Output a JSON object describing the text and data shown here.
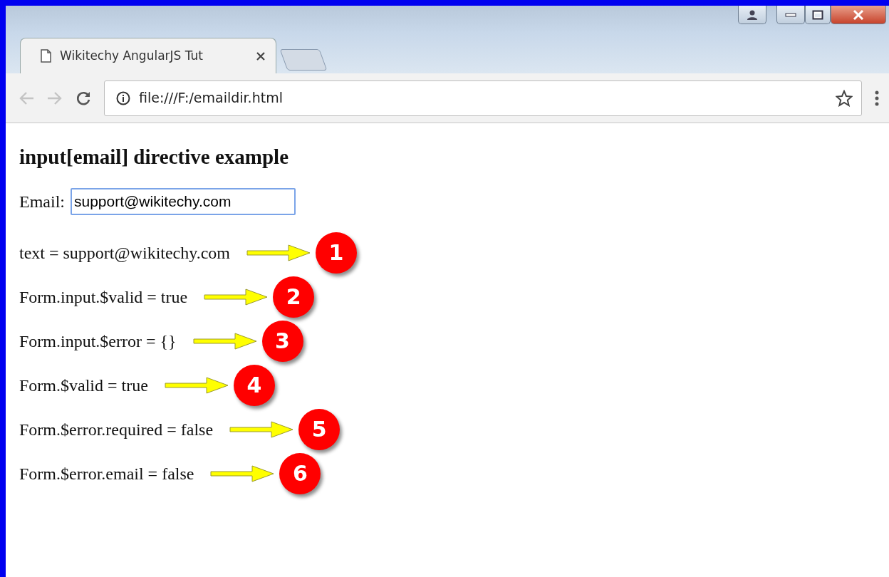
{
  "browser": {
    "tab_title": "Wikitechy AngularJS Tut",
    "address": "file:///F:/emaildir.html"
  },
  "page": {
    "heading": "input[email] directive example",
    "email_label": "Email:",
    "email_value": "support@wikitechy.com",
    "lines": [
      {
        "text": "text = support@wikitechy.com",
        "badge": "1"
      },
      {
        "text": "Form.input.$valid = true",
        "badge": "2"
      },
      {
        "text": "Form.input.$error = {}",
        "badge": "3"
      },
      {
        "text": "Form.$valid = true",
        "badge": "4"
      },
      {
        "text": "Form.$error.required = false",
        "badge": "5"
      },
      {
        "text": "Form.$error.email = false",
        "badge": "6"
      }
    ]
  }
}
